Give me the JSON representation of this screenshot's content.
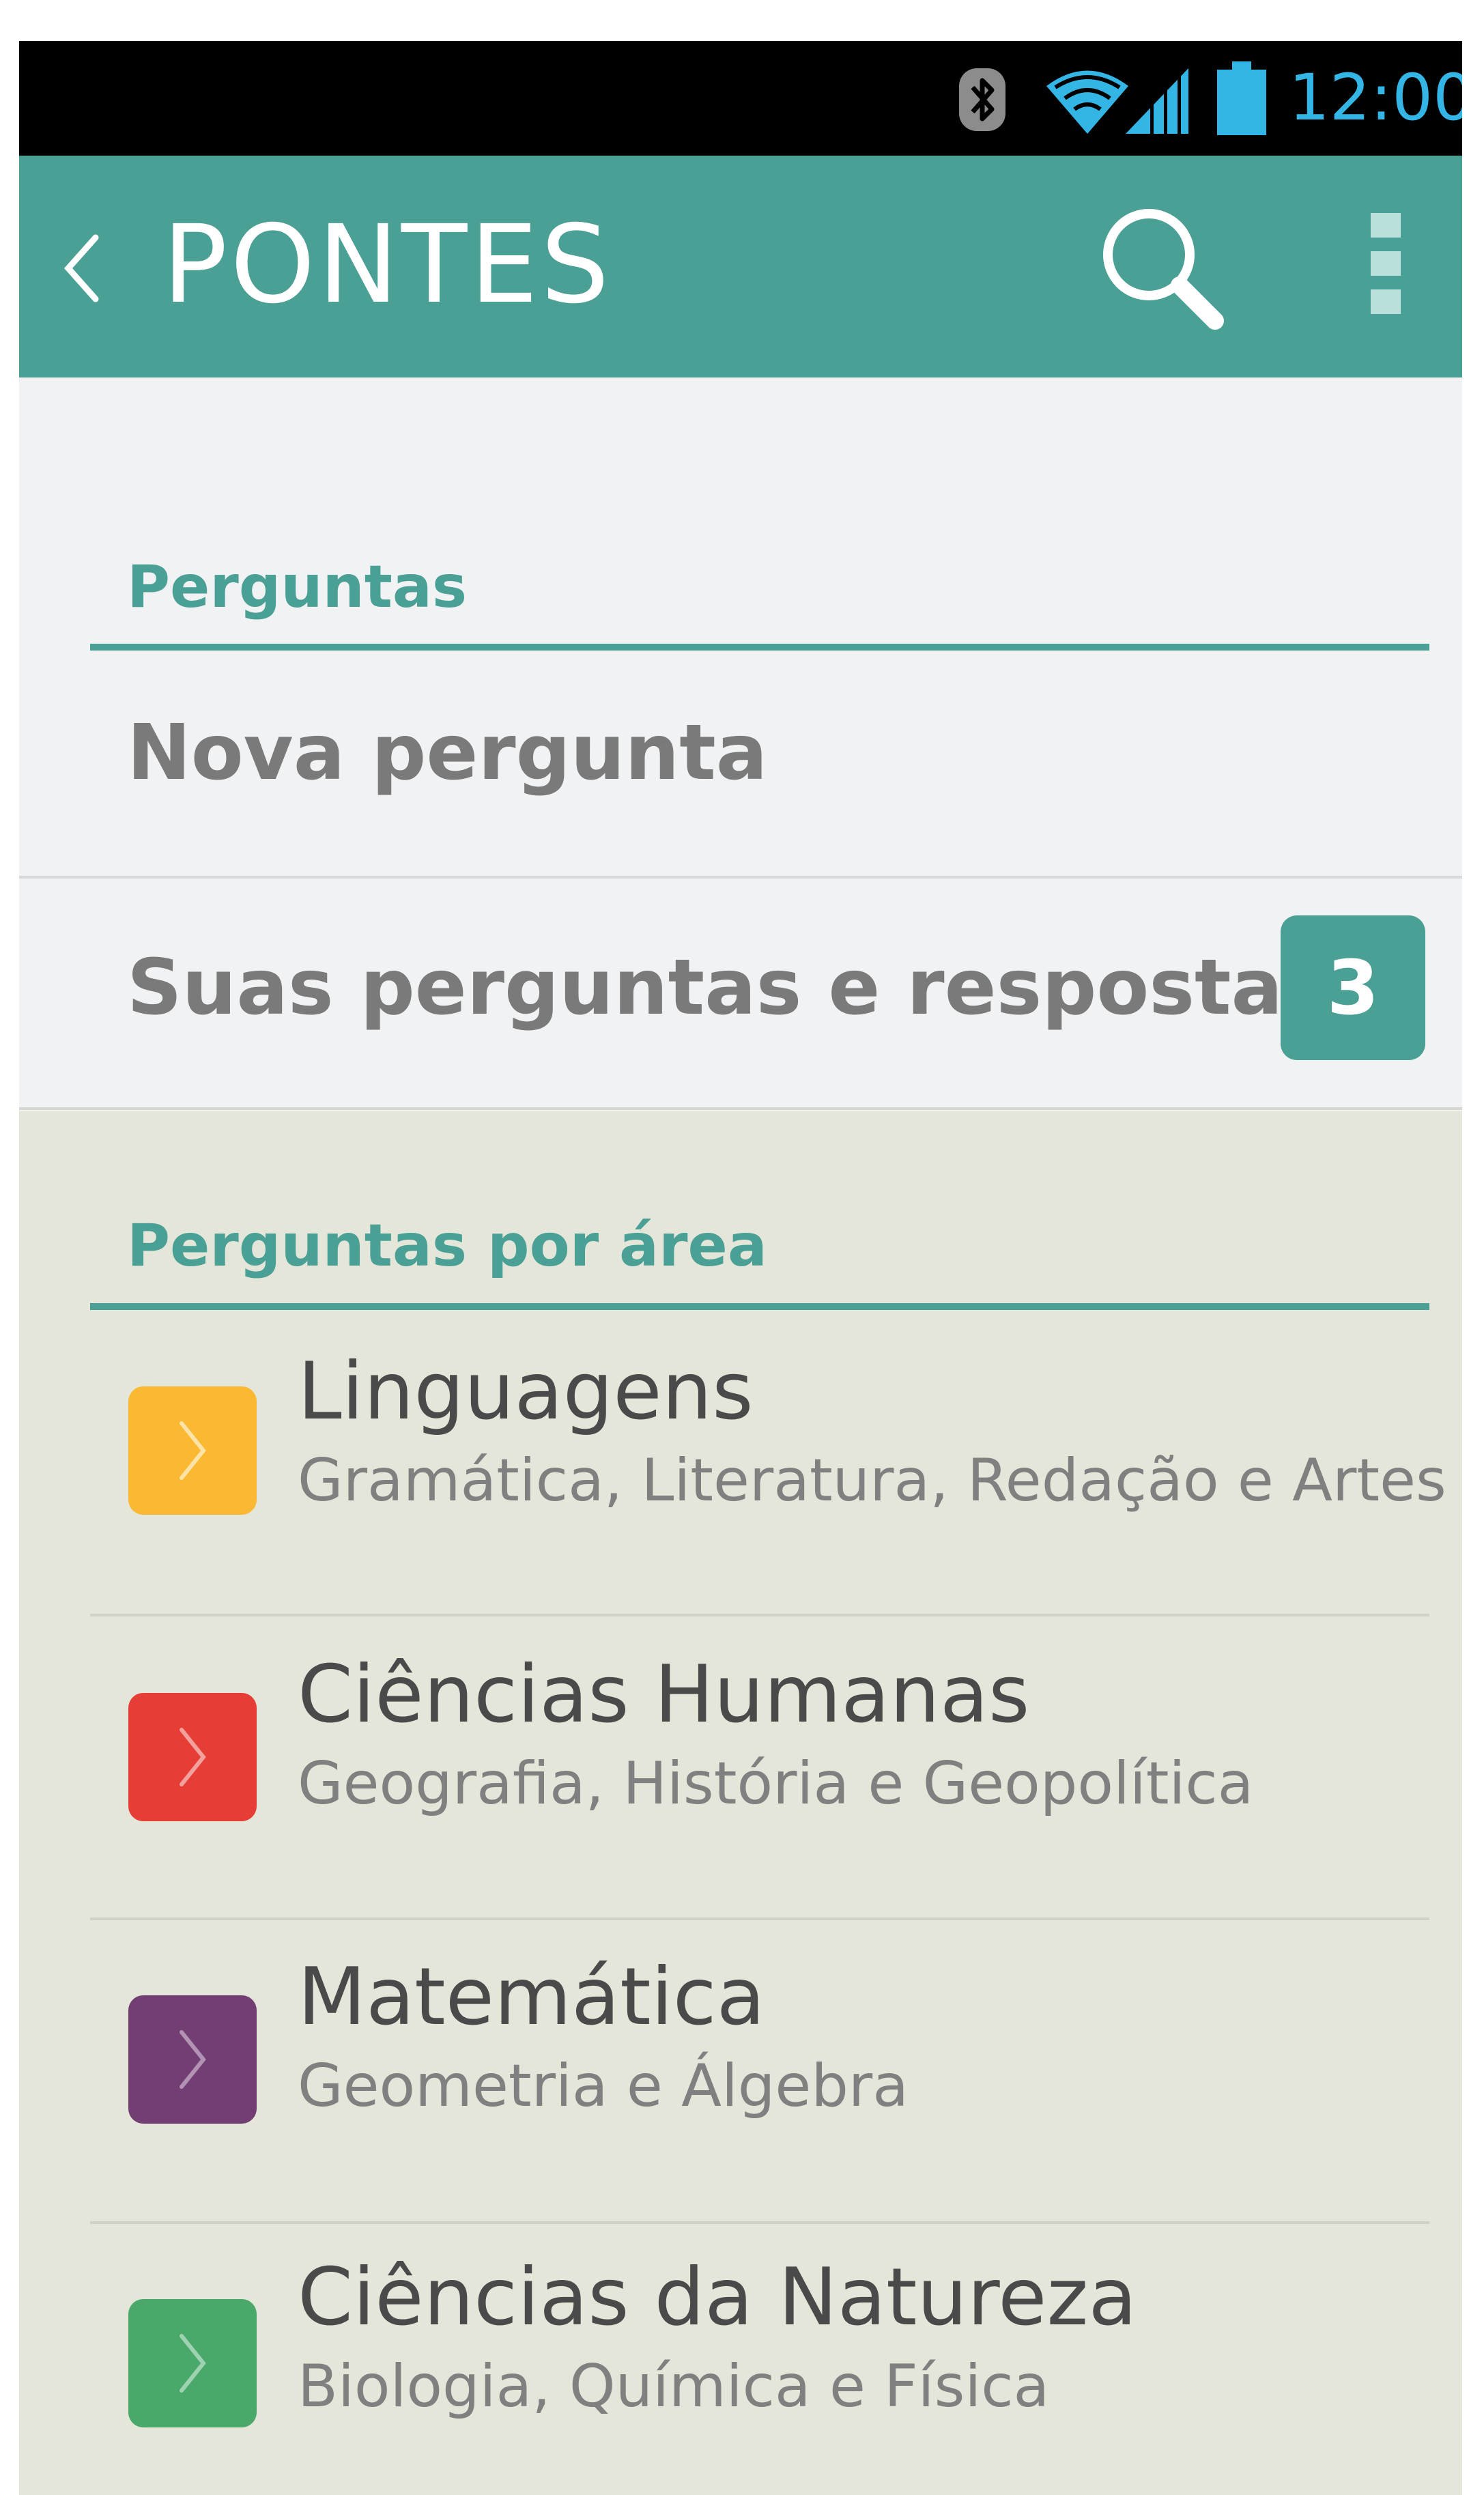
{
  "status_bar": {
    "time": "12:00",
    "icons": [
      "bluetooth-icon",
      "wifi-icon",
      "signal-icon",
      "battery-icon"
    ]
  },
  "app_bar": {
    "title": "PONTES",
    "back_icon": "chevron-left-icon",
    "search_icon": "search-icon",
    "menu_icon": "more-vert-icon",
    "color": "#4ba096"
  },
  "questions_section": {
    "header": "Perguntas",
    "items": [
      {
        "label": "Nova pergunta"
      },
      {
        "label": "Suas perguntas e respostas",
        "badge": "3"
      }
    ]
  },
  "areas_section": {
    "header": "Perguntas por área",
    "items": [
      {
        "title": "Linguagens",
        "subtitle": "Gramática, Literatura, Redação e Artes",
        "color": "#fbb933",
        "icon": "chevron-right-icon"
      },
      {
        "title": "Ciências Humanas",
        "subtitle": "Geografia, História e Geopolítica",
        "color": "#e63d36",
        "icon": "chevron-right-icon"
      },
      {
        "title": "Matemática",
        "subtitle": "Geometria e Álgebra",
        "color": "#733e74",
        "icon": "chevron-right-icon"
      },
      {
        "title": "Ciências da Natureza",
        "subtitle": "Biologia, Química e Física",
        "color": "#4aa86b",
        "icon": "chevron-right-icon"
      }
    ]
  }
}
